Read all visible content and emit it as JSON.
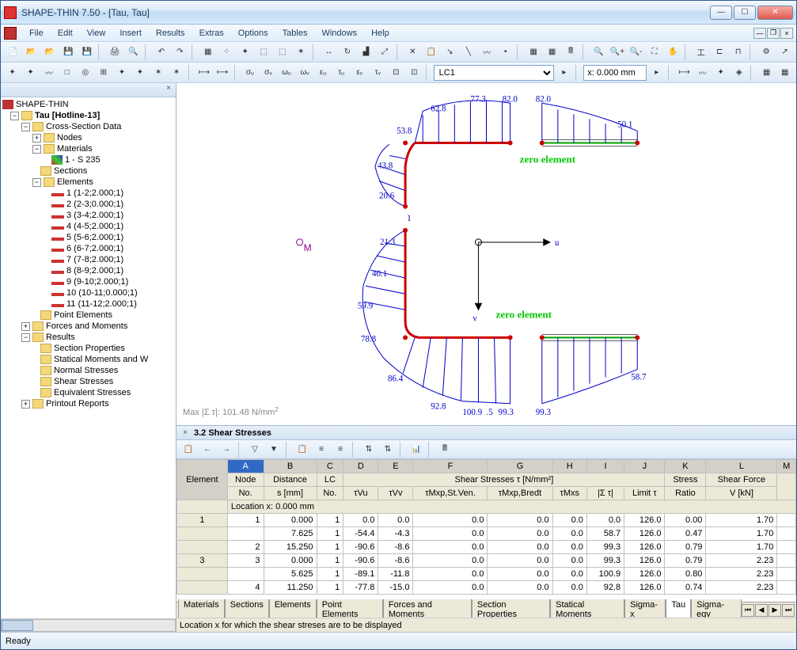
{
  "window": {
    "title": "SHAPE-THIN 7.50 - [Tau, Tau]"
  },
  "menu": [
    "File",
    "Edit",
    "View",
    "Insert",
    "Results",
    "Extras",
    "Options",
    "Tables",
    "Windows",
    "Help"
  ],
  "toolbar2": {
    "lc_select": "LC1",
    "x_input": "x: 0.000 mm"
  },
  "tree": {
    "root": "SHAPE-THIN",
    "model": "Tau [Hotline-13]",
    "cross_section": "Cross-Section Data",
    "nodes": "Nodes",
    "materials": "Materials",
    "mat1": "1 - S 235",
    "sections": "Sections",
    "elements_label": "Elements",
    "elements": [
      "1 (1-2;2.000;1)",
      "2 (2-3;0.000;1)",
      "3 (3-4;2.000;1)",
      "4 (4-5;2.000;1)",
      "5 (5-6;2.000;1)",
      "6 (6-7;2.000;1)",
      "7 (7-8;2.000;1)",
      "8 (8-9;2.000;1)",
      "9 (9-10;2.000;1)",
      "10 (10-11;0.000;1)",
      "11 (11-12;2.000;1)"
    ],
    "point_elements": "Point Elements",
    "forces": "Forces and Moments",
    "results": "Results",
    "result_items": [
      "Section Properties",
      "Statical Moments and W",
      "Normal Stresses",
      "Shear Stresses",
      "Equivalent Stresses"
    ],
    "printout": "Printout Reports"
  },
  "canvas": {
    "m_label": "M",
    "u_label": "u",
    "v_label": "v",
    "zero1": "zero element",
    "zero2": "zero element",
    "max_note_prefix": "Max |Σ τ|: 101.48 N/mm",
    "max_note_sup": "2",
    "one_label": "1",
    "stress_vals": {
      "a": "82.0",
      "b": "77.3",
      "c": "62.8",
      "d": "53.8",
      "e": "43.8",
      "f": "20.6",
      "g": "21.3",
      "h": "40.1",
      "i": "59.9",
      "j": "78.8",
      "k": "86.4",
      "l": "92.8",
      "m": "100.9",
      "n": "99.3",
      "o": "99.3",
      "p": "58.7",
      "q": "82.0",
      "r": "50.1",
      "s": ".5"
    }
  },
  "table": {
    "title": "3.2 Shear Stresses",
    "col_letters": [
      "A",
      "B",
      "C",
      "D",
      "E",
      "F",
      "G",
      "H",
      "I",
      "J",
      "K",
      "L",
      "M"
    ],
    "headers1": {
      "element": "Element",
      "node": "Node",
      "dist": "Distance",
      "lc": "LC",
      "shear_group": "Shear Stresses τ [N/mm²]",
      "stress": "Stress",
      "shearforce": "Shear Force"
    },
    "headers2": {
      "no": "No.",
      "no2": "No.",
      "s": "s [mm]",
      "no3": "No.",
      "tvu": "τVu",
      "tvv": "τVv",
      "tmxpst": "τMxp,St.Ven.",
      "tmxpbr": "τMxp,Bredt",
      "tmxs": "τMxs",
      "sumtau": "|Σ τ|",
      "limit": "Limit τ",
      "ratio": "Ratio",
      "v": "V [kN]"
    },
    "location_row": "Location x: 0.000 mm",
    "rows": [
      {
        "elem": "1",
        "node": "1",
        "s": "0.000",
        "lc": "1",
        "tvu": "0.0",
        "tvv": "0.0",
        "st": "0.0",
        "br": "0.0",
        "mxs": "0.0",
        "sum": "0.0",
        "lim": "126.0",
        "ratio": "0.00",
        "v": "1.70"
      },
      {
        "elem": "",
        "node": "",
        "s": "7.625",
        "lc": "1",
        "tvu": "-54.4",
        "tvv": "-4.3",
        "st": "0.0",
        "br": "0.0",
        "mxs": "0.0",
        "sum": "58.7",
        "lim": "126.0",
        "ratio": "0.47",
        "v": "1.70"
      },
      {
        "elem": "",
        "node": "2",
        "s": "15.250",
        "lc": "1",
        "tvu": "-90.6",
        "tvv": "-8.6",
        "st": "0.0",
        "br": "0.0",
        "mxs": "0.0",
        "sum": "99.3",
        "lim": "126.0",
        "ratio": "0.79",
        "v": "1.70"
      },
      {
        "elem": "3",
        "node": "3",
        "s": "0.000",
        "lc": "1",
        "tvu": "-90.6",
        "tvv": "-8.6",
        "st": "0.0",
        "br": "0.0",
        "mxs": "0.0",
        "sum": "99.3",
        "lim": "126.0",
        "ratio": "0.79",
        "v": "2.23"
      },
      {
        "elem": "",
        "node": "",
        "s": "5.625",
        "lc": "1",
        "tvu": "-89.1",
        "tvv": "-11.8",
        "st": "0.0",
        "br": "0.0",
        "mxs": "0.0",
        "sum": "100.9",
        "lim": "126.0",
        "ratio": "0.80",
        "v": "2.23"
      },
      {
        "elem": "",
        "node": "4",
        "s": "11.250",
        "lc": "1",
        "tvu": "-77.8",
        "tvv": "-15.0",
        "st": "0.0",
        "br": "0.0",
        "mxs": "0.0",
        "sum": "92.8",
        "lim": "126.0",
        "ratio": "0.74",
        "v": "2.23"
      }
    ],
    "tabs": [
      "Materials",
      "Sections",
      "Elements",
      "Point Elements",
      "Forces and Moments",
      "Section Properties",
      "Statical Moments",
      "Sigma-x",
      "Tau",
      "Sigma-eqv"
    ],
    "active_tab": 8,
    "desc": "Location x for which the shear streses are to be displayed"
  },
  "status": {
    "ready": "Ready"
  }
}
